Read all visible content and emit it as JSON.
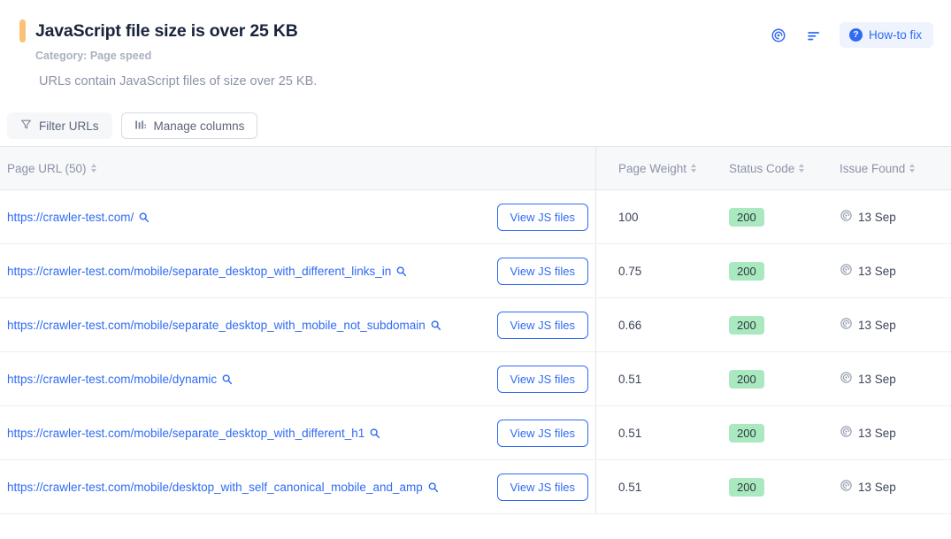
{
  "header": {
    "title": "JavaScript file size is over 25 KB",
    "category": "Category: Page speed",
    "description": "URLs contain JavaScript files of size over 25 KB.",
    "accent_color": "#fbc277",
    "actions": {
      "radar_icon": "radar-icon",
      "sort_icon": "sort-descending-icon",
      "howto_label": "How-to fix",
      "howto_icon": "question-mark-icon",
      "howto_color": "#2f6bf3"
    }
  },
  "toolbar": {
    "filter_label": "Filter URLs",
    "filter_icon": "funnel-icon",
    "manage_label": "Manage columns",
    "manage_icon": "columns-icon"
  },
  "table": {
    "columns": [
      {
        "label": "Page URL (50)",
        "sortable": true
      },
      {
        "label": "Page Weight",
        "sortable": true
      },
      {
        "label": "Status Code",
        "sortable": true
      },
      {
        "label": "Issue Found",
        "sortable": true
      }
    ],
    "row_action_label": "View JS files",
    "rows": [
      {
        "url": "https://crawler-test.com/",
        "action": "View JS files",
        "page_weight": "100",
        "status_code": "200",
        "issue_found": "13 Sep"
      },
      {
        "url": "https://crawler-test.com/mobile/separate_desktop_with_different_links_in",
        "action": "View JS files",
        "page_weight": "0.75",
        "status_code": "200",
        "issue_found": "13 Sep"
      },
      {
        "url": "https://crawler-test.com/mobile/separate_desktop_with_mobile_not_subdomain",
        "action": "View JS files",
        "page_weight": "0.66",
        "status_code": "200",
        "issue_found": "13 Sep"
      },
      {
        "url": "https://crawler-test.com/mobile/dynamic",
        "action": "View JS files",
        "page_weight": "0.51",
        "status_code": "200",
        "issue_found": "13 Sep"
      },
      {
        "url": "https://crawler-test.com/mobile/separate_desktop_with_different_h1",
        "action": "View JS files",
        "page_weight": "0.51",
        "status_code": "200",
        "issue_found": "13 Sep"
      },
      {
        "url": "https://crawler-test.com/mobile/desktop_with_self_canonical_mobile_and_amp",
        "action": "View JS files",
        "page_weight": "0.51",
        "status_code": "200",
        "issue_found": "13 Sep"
      }
    ],
    "status_badge_color": "#aae8bf",
    "link_color": "#2f6bf3",
    "search_icon": "magnifier-icon",
    "issue_icon": "radar-icon"
  }
}
